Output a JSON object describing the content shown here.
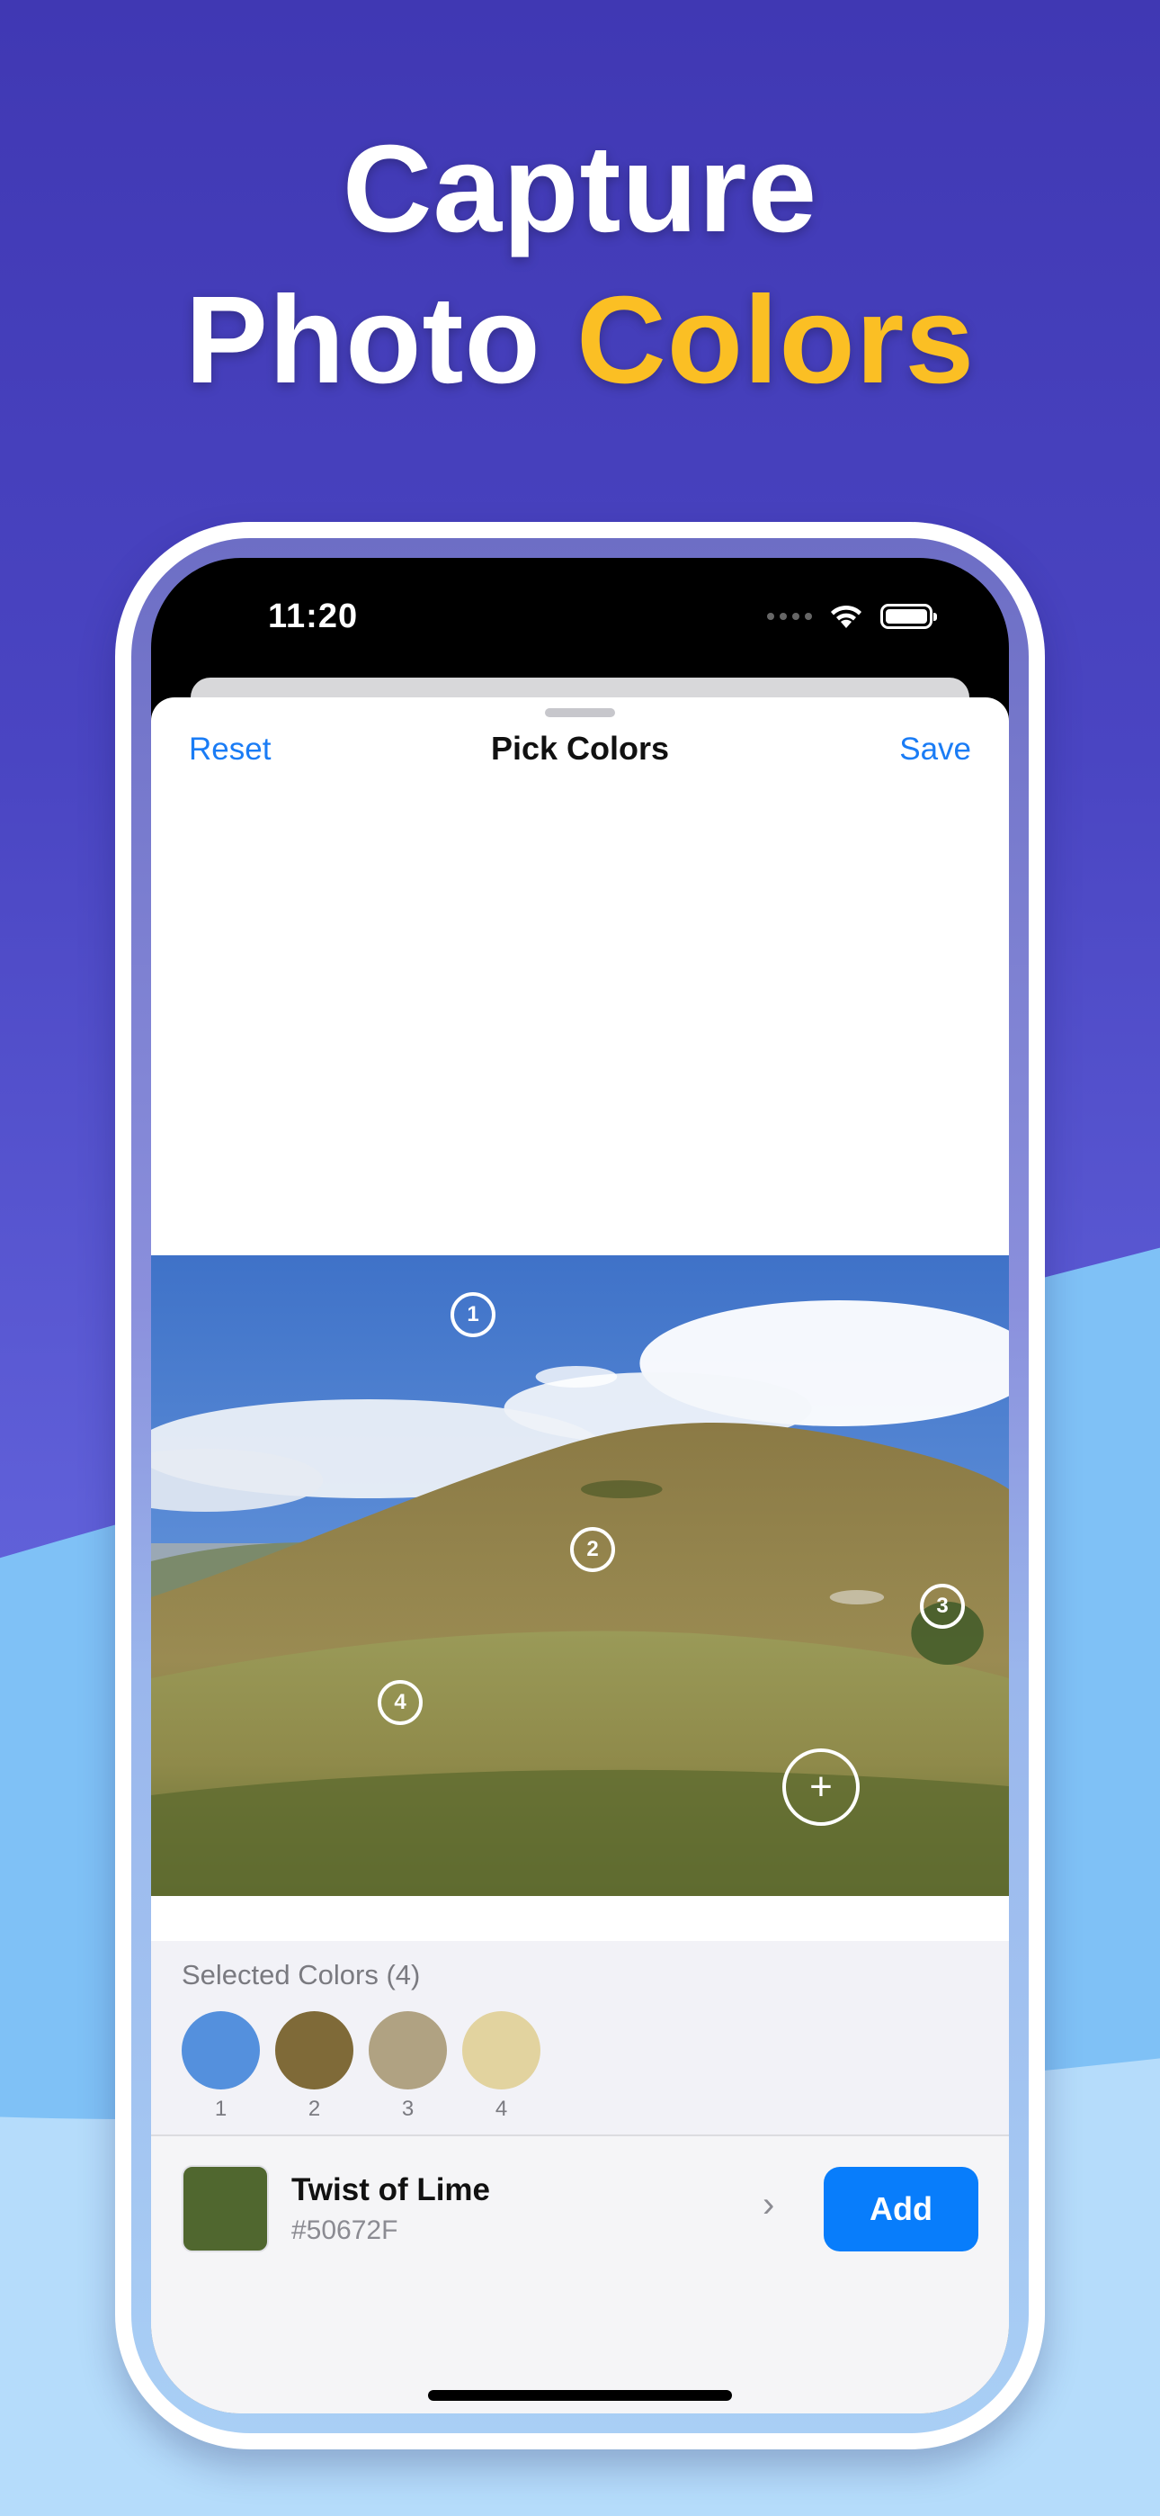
{
  "headline": {
    "line1": "Capture",
    "line2_white": "Photo",
    "line2_accent": "Colors"
  },
  "colors": {
    "accent": "#fbbf24",
    "link_blue": "#1a7cf5",
    "button_blue": "#087dfb"
  },
  "status_bar": {
    "time": "11:20",
    "icons": [
      "signal-dots-icon",
      "wifi-icon",
      "battery-icon"
    ]
  },
  "nav": {
    "left": "Reset",
    "title": "Pick Colors",
    "right": "Save"
  },
  "photo": {
    "markers": [
      "1",
      "2",
      "3",
      "4"
    ],
    "add_marker_icon": "plus-icon"
  },
  "selected": {
    "title": "Selected Colors (4)",
    "swatches": [
      {
        "label": "1",
        "color": "#5490dd"
      },
      {
        "label": "2",
        "color": "#7f6a38"
      },
      {
        "label": "3",
        "color": "#b0a282"
      },
      {
        "label": "4",
        "color": "#e2d39f"
      }
    ]
  },
  "current_color": {
    "name": "Twist of Lime",
    "hex": "#50672F",
    "chevron": "›",
    "add_label": "Add"
  }
}
